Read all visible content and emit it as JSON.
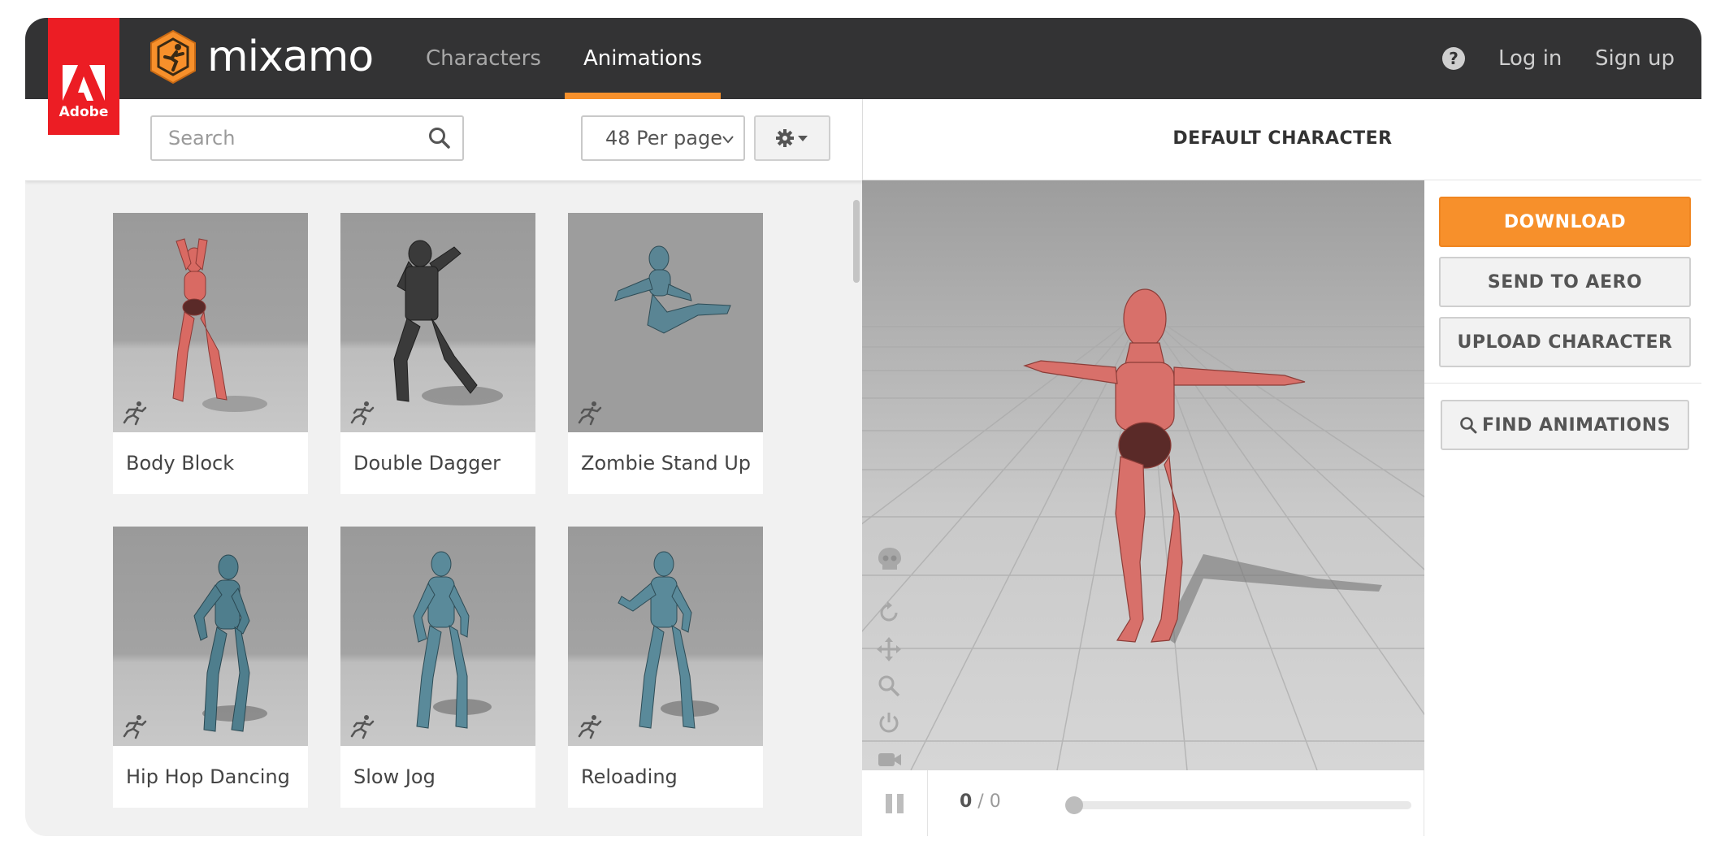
{
  "brand": {
    "adobe_label": "Adobe",
    "logo_text": "mixamo",
    "accent_color": "#f7902b",
    "adobe_red": "#ec1d24"
  },
  "nav": {
    "tabs": [
      {
        "label": "Characters",
        "active": false
      },
      {
        "label": "Animations",
        "active": true
      }
    ],
    "help_icon": "question-circle-icon",
    "login_label": "Log in",
    "signup_label": "Sign up"
  },
  "toolbar": {
    "search_placeholder": "Search",
    "search_value": "",
    "per_page_value": "48 Per page",
    "settings_icon": "gear-icon"
  },
  "animations": [
    {
      "name": "Body Block",
      "figure_color": "#d96a63"
    },
    {
      "name": "Double Dagger",
      "figure_color": "#3a3a3a"
    },
    {
      "name": "Zombie Stand Up",
      "figure_color": "#5a8594"
    },
    {
      "name": "Hip Hop Dancing",
      "figure_color": "#4f7e8d"
    },
    {
      "name": "Slow Jog",
      "figure_color": "#5a8a9a"
    },
    {
      "name": "Reloading",
      "figure_color": "#5a8a9a"
    }
  ],
  "character": {
    "title": "DEFAULT CHARACTER",
    "figure_color": "#d8706a"
  },
  "viewer_tools": [
    "skull-icon",
    "rotate-icon",
    "move-icon",
    "zoom-icon",
    "power-icon",
    "camera-icon"
  ],
  "playback": {
    "current_frame": "0",
    "separator": " / ",
    "total_frames": "0",
    "progress": 0
  },
  "actions": {
    "download_label": "DOWNLOAD",
    "send_aero_label": "SEND TO AERO",
    "upload_label": "UPLOAD CHARACTER",
    "find_label": "FIND ANIMATIONS"
  }
}
